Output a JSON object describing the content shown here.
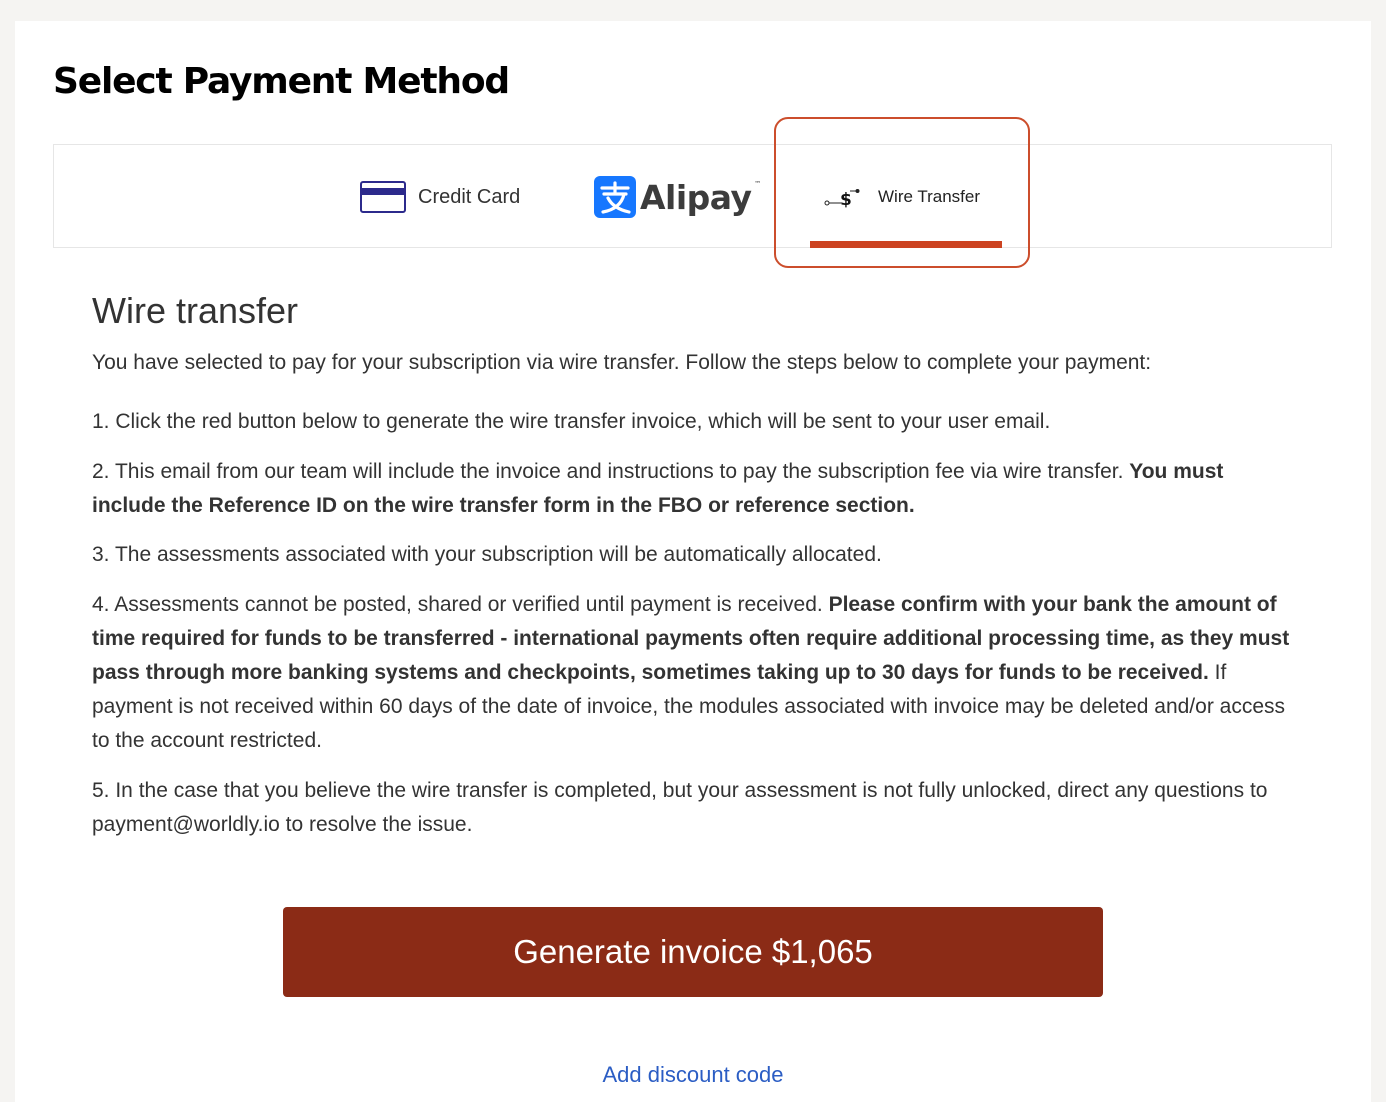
{
  "page": {
    "title": "Select Payment Method"
  },
  "tabs": {
    "credit_card": {
      "label": "Credit Card",
      "icon": "credit-card-icon"
    },
    "alipay": {
      "label": "Alipay",
      "trademark": "™",
      "icon": "alipay-icon"
    },
    "wire_transfer": {
      "label": "Wire Transfer",
      "icon": "wire-transfer-icon",
      "active": true
    }
  },
  "wire_section": {
    "heading": "Wire transfer",
    "intro": "You have selected to pay for your subscription via wire transfer. Follow the steps below to complete your payment:",
    "step1": "1. Click the red button below to generate the wire transfer invoice, which will be sent to your user email.",
    "step2_text": "2. This email from our team will include the invoice and instructions to pay the subscription fee via wire transfer. ",
    "step2_bold": "You must include the Reference ID on the wire transfer form in the FBO or reference section.",
    "step3": "3. The assessments associated with your subscription will be automatically allocated.",
    "step4_text": "4. Assessments cannot be posted, shared or verified until payment is received. ",
    "step4_bold": "Please confirm with your bank the amount of time required for funds to be transferred - international payments often require additional processing time, as they must pass through more banking systems and checkpoints, sometimes taking up to 30 days for funds to be received.",
    "step4_tail": " If payment is not received within 60 days of the date of invoice, the modules associated with invoice may be deleted and/or access to the account restricted.",
    "step5": "5. In the case that you believe the wire transfer is completed, but your assessment is not fully unlocked, direct any questions to payment@worldly.io to resolve the issue."
  },
  "actions": {
    "generate_label": "Generate invoice $1,065",
    "discount_label": "Add discount code"
  },
  "colors": {
    "accent": "#cc4321",
    "button": "#8b2b16",
    "link": "#2b5dc4",
    "alipay_blue": "#1677ff"
  }
}
